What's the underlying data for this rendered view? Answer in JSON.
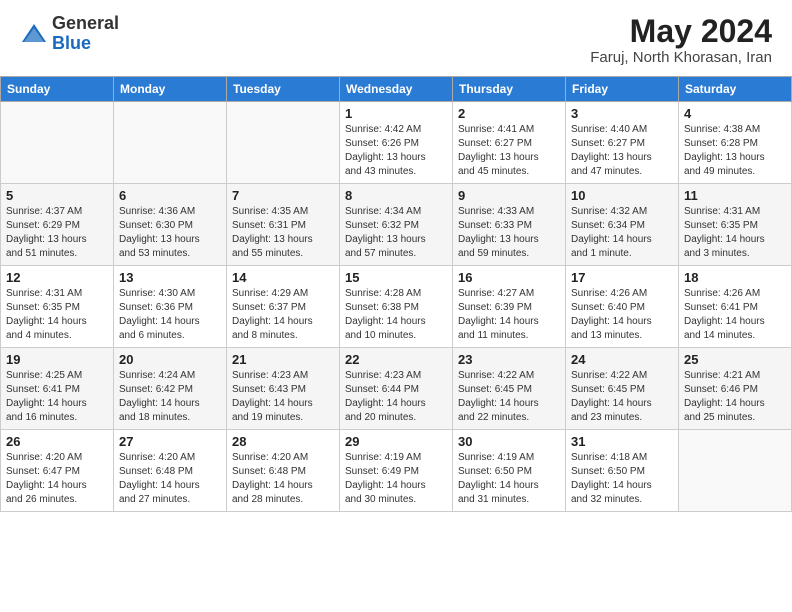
{
  "header": {
    "logo_general": "General",
    "logo_blue": "Blue",
    "month_title": "May 2024",
    "subtitle": "Faruj, North Khorasan, Iran"
  },
  "days_of_week": [
    "Sunday",
    "Monday",
    "Tuesday",
    "Wednesday",
    "Thursday",
    "Friday",
    "Saturday"
  ],
  "weeks": [
    [
      {
        "day": "",
        "info": ""
      },
      {
        "day": "",
        "info": ""
      },
      {
        "day": "",
        "info": ""
      },
      {
        "day": "1",
        "info": "Sunrise: 4:42 AM\nSunset: 6:26 PM\nDaylight: 13 hours\nand 43 minutes."
      },
      {
        "day": "2",
        "info": "Sunrise: 4:41 AM\nSunset: 6:27 PM\nDaylight: 13 hours\nand 45 minutes."
      },
      {
        "day": "3",
        "info": "Sunrise: 4:40 AM\nSunset: 6:27 PM\nDaylight: 13 hours\nand 47 minutes."
      },
      {
        "day": "4",
        "info": "Sunrise: 4:38 AM\nSunset: 6:28 PM\nDaylight: 13 hours\nand 49 minutes."
      }
    ],
    [
      {
        "day": "5",
        "info": "Sunrise: 4:37 AM\nSunset: 6:29 PM\nDaylight: 13 hours\nand 51 minutes."
      },
      {
        "day": "6",
        "info": "Sunrise: 4:36 AM\nSunset: 6:30 PM\nDaylight: 13 hours\nand 53 minutes."
      },
      {
        "day": "7",
        "info": "Sunrise: 4:35 AM\nSunset: 6:31 PM\nDaylight: 13 hours\nand 55 minutes."
      },
      {
        "day": "8",
        "info": "Sunrise: 4:34 AM\nSunset: 6:32 PM\nDaylight: 13 hours\nand 57 minutes."
      },
      {
        "day": "9",
        "info": "Sunrise: 4:33 AM\nSunset: 6:33 PM\nDaylight: 13 hours\nand 59 minutes."
      },
      {
        "day": "10",
        "info": "Sunrise: 4:32 AM\nSunset: 6:34 PM\nDaylight: 14 hours\nand 1 minute."
      },
      {
        "day": "11",
        "info": "Sunrise: 4:31 AM\nSunset: 6:35 PM\nDaylight: 14 hours\nand 3 minutes."
      }
    ],
    [
      {
        "day": "12",
        "info": "Sunrise: 4:31 AM\nSunset: 6:35 PM\nDaylight: 14 hours\nand 4 minutes."
      },
      {
        "day": "13",
        "info": "Sunrise: 4:30 AM\nSunset: 6:36 PM\nDaylight: 14 hours\nand 6 minutes."
      },
      {
        "day": "14",
        "info": "Sunrise: 4:29 AM\nSunset: 6:37 PM\nDaylight: 14 hours\nand 8 minutes."
      },
      {
        "day": "15",
        "info": "Sunrise: 4:28 AM\nSunset: 6:38 PM\nDaylight: 14 hours\nand 10 minutes."
      },
      {
        "day": "16",
        "info": "Sunrise: 4:27 AM\nSunset: 6:39 PM\nDaylight: 14 hours\nand 11 minutes."
      },
      {
        "day": "17",
        "info": "Sunrise: 4:26 AM\nSunset: 6:40 PM\nDaylight: 14 hours\nand 13 minutes."
      },
      {
        "day": "18",
        "info": "Sunrise: 4:26 AM\nSunset: 6:41 PM\nDaylight: 14 hours\nand 14 minutes."
      }
    ],
    [
      {
        "day": "19",
        "info": "Sunrise: 4:25 AM\nSunset: 6:41 PM\nDaylight: 14 hours\nand 16 minutes."
      },
      {
        "day": "20",
        "info": "Sunrise: 4:24 AM\nSunset: 6:42 PM\nDaylight: 14 hours\nand 18 minutes."
      },
      {
        "day": "21",
        "info": "Sunrise: 4:23 AM\nSunset: 6:43 PM\nDaylight: 14 hours\nand 19 minutes."
      },
      {
        "day": "22",
        "info": "Sunrise: 4:23 AM\nSunset: 6:44 PM\nDaylight: 14 hours\nand 20 minutes."
      },
      {
        "day": "23",
        "info": "Sunrise: 4:22 AM\nSunset: 6:45 PM\nDaylight: 14 hours\nand 22 minutes."
      },
      {
        "day": "24",
        "info": "Sunrise: 4:22 AM\nSunset: 6:45 PM\nDaylight: 14 hours\nand 23 minutes."
      },
      {
        "day": "25",
        "info": "Sunrise: 4:21 AM\nSunset: 6:46 PM\nDaylight: 14 hours\nand 25 minutes."
      }
    ],
    [
      {
        "day": "26",
        "info": "Sunrise: 4:20 AM\nSunset: 6:47 PM\nDaylight: 14 hours\nand 26 minutes."
      },
      {
        "day": "27",
        "info": "Sunrise: 4:20 AM\nSunset: 6:48 PM\nDaylight: 14 hours\nand 27 minutes."
      },
      {
        "day": "28",
        "info": "Sunrise: 4:20 AM\nSunset: 6:48 PM\nDaylight: 14 hours\nand 28 minutes."
      },
      {
        "day": "29",
        "info": "Sunrise: 4:19 AM\nSunset: 6:49 PM\nDaylight: 14 hours\nand 30 minutes."
      },
      {
        "day": "30",
        "info": "Sunrise: 4:19 AM\nSunset: 6:50 PM\nDaylight: 14 hours\nand 31 minutes."
      },
      {
        "day": "31",
        "info": "Sunrise: 4:18 AM\nSunset: 6:50 PM\nDaylight: 14 hours\nand 32 minutes."
      },
      {
        "day": "",
        "info": ""
      }
    ]
  ]
}
